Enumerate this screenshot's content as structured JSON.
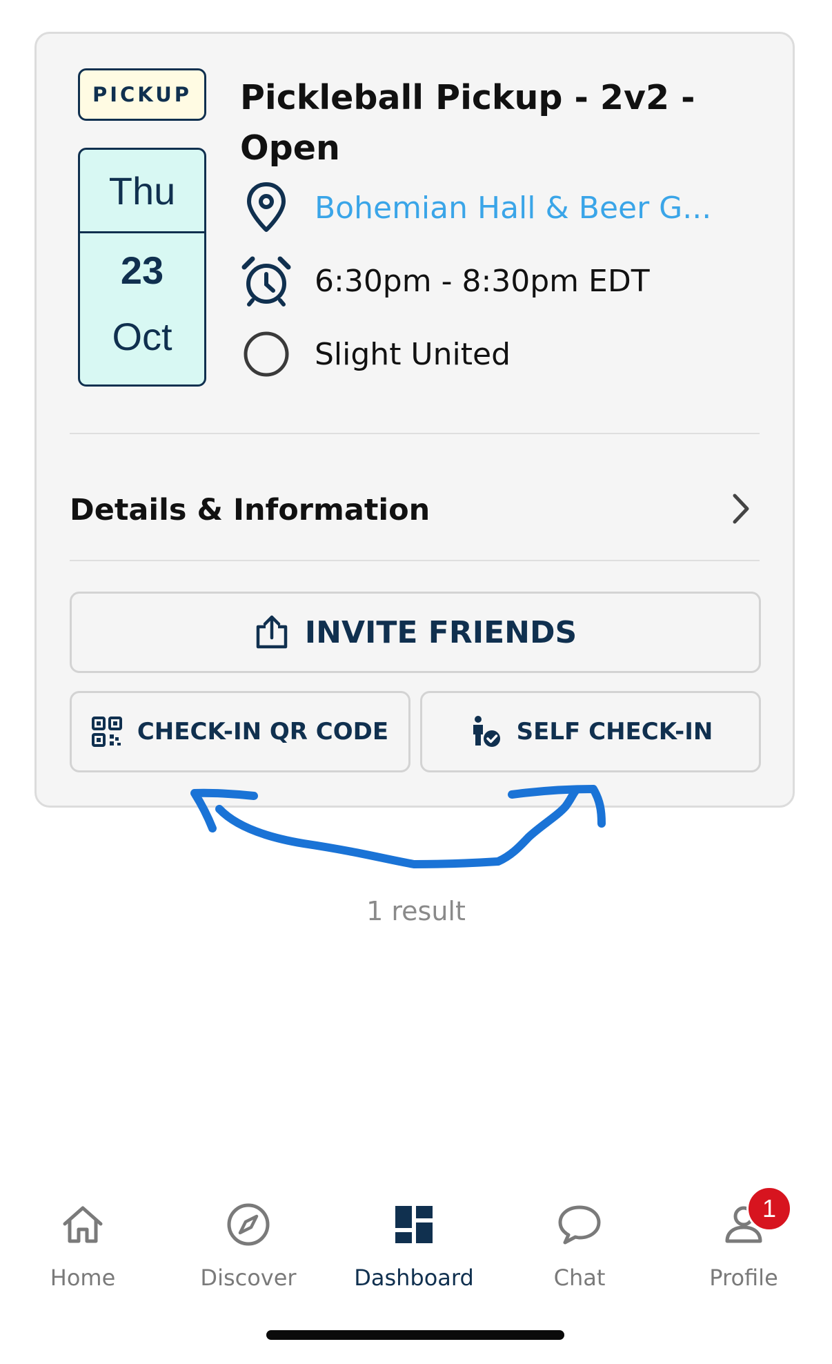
{
  "event": {
    "tag": "PICKUP",
    "date": {
      "weekday": "Thu",
      "day": "23",
      "month": "Oct"
    },
    "title": "Pickleball Pickup - 2v2 - Open",
    "location": "Bohemian Hall & Beer G...",
    "time": "6:30pm - 8:30pm EDT",
    "organizer": "Slight United",
    "details_label": "Details & Information",
    "buttons": {
      "invite": "INVITE FRIENDS",
      "qr": "CHECK-IN QR CODE",
      "self_checkin": "SELF CHECK-IN"
    }
  },
  "results": {
    "count_text": "1 result"
  },
  "tabbar": {
    "items": [
      {
        "label": "Home",
        "icon": "home-icon"
      },
      {
        "label": "Discover",
        "icon": "compass-icon"
      },
      {
        "label": "Dashboard",
        "icon": "dashboard-icon",
        "active": true
      },
      {
        "label": "Chat",
        "icon": "chat-bubble-icon"
      },
      {
        "label": "Profile",
        "icon": "profile-icon",
        "badge": "1"
      }
    ]
  },
  "colors": {
    "navy": "#10304f",
    "link": "#3aa5e8",
    "badge": "#d7141f",
    "annotation": "#1a73d6",
    "date_bg": "#d8f8f3",
    "tag_bg": "#fffbe3"
  }
}
